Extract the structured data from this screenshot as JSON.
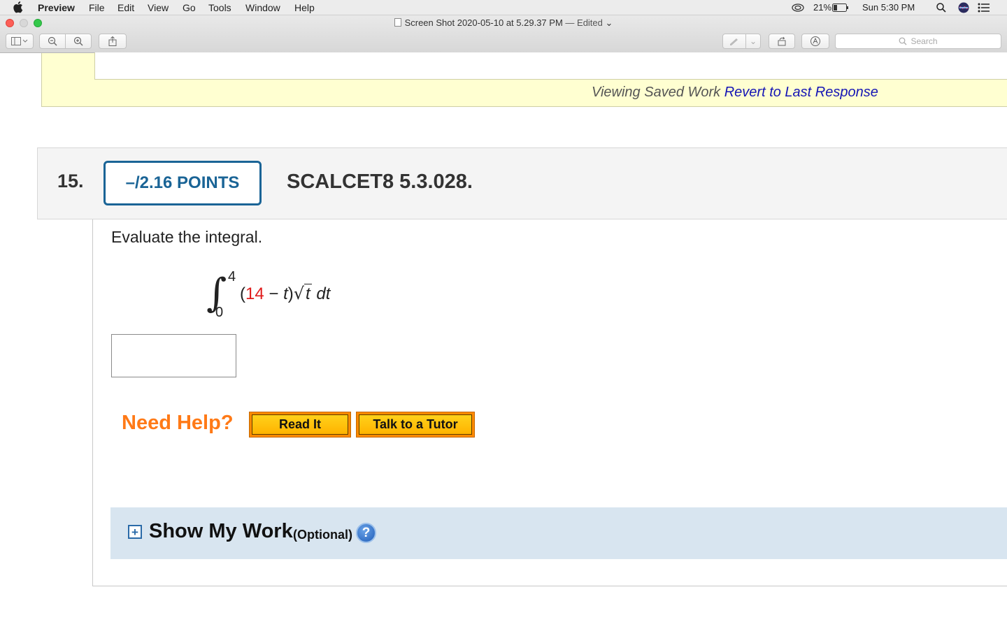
{
  "menubar": {
    "app_name": "Preview",
    "items": [
      "File",
      "Edit",
      "View",
      "Go",
      "Tools",
      "Window",
      "Help"
    ],
    "battery": "21%",
    "clock": "Sun 5:30 PM"
  },
  "window": {
    "title": "Screen Shot 2020-05-10 at 5.29.37 PM",
    "edited": "— Edited",
    "search_placeholder": "Search"
  },
  "banner": {
    "viewing": "Viewing Saved Work",
    "revert": "Revert to Last Response"
  },
  "question": {
    "number": "15.",
    "points": "–/2.16 POINTS",
    "code": "SCALCET8 5.3.028.",
    "prompt": "Evaluate the integral.",
    "integral": {
      "upper": "4",
      "lower": "0",
      "open_paren": "(",
      "constant": "14",
      "minus": " − ",
      "variable": "t",
      "close_paren": ")",
      "sqrt_arg": "t",
      "differential": "dt"
    },
    "answer_value": ""
  },
  "help": {
    "label": "Need Help?",
    "read_it": "Read It",
    "talk_tutor": "Talk to a Tutor"
  },
  "show_work": {
    "title": "Show My Work",
    "optional": "(Optional)",
    "help_glyph": "?",
    "expand_glyph": "+"
  },
  "colors": {
    "points_blue": "#1a6496",
    "help_orange": "#ff7a17",
    "revert_link": "#1515b5",
    "constant_red": "#e01b1b",
    "banner_yellow": "#ffffd1",
    "showwork_blue": "#d8e5f0"
  }
}
